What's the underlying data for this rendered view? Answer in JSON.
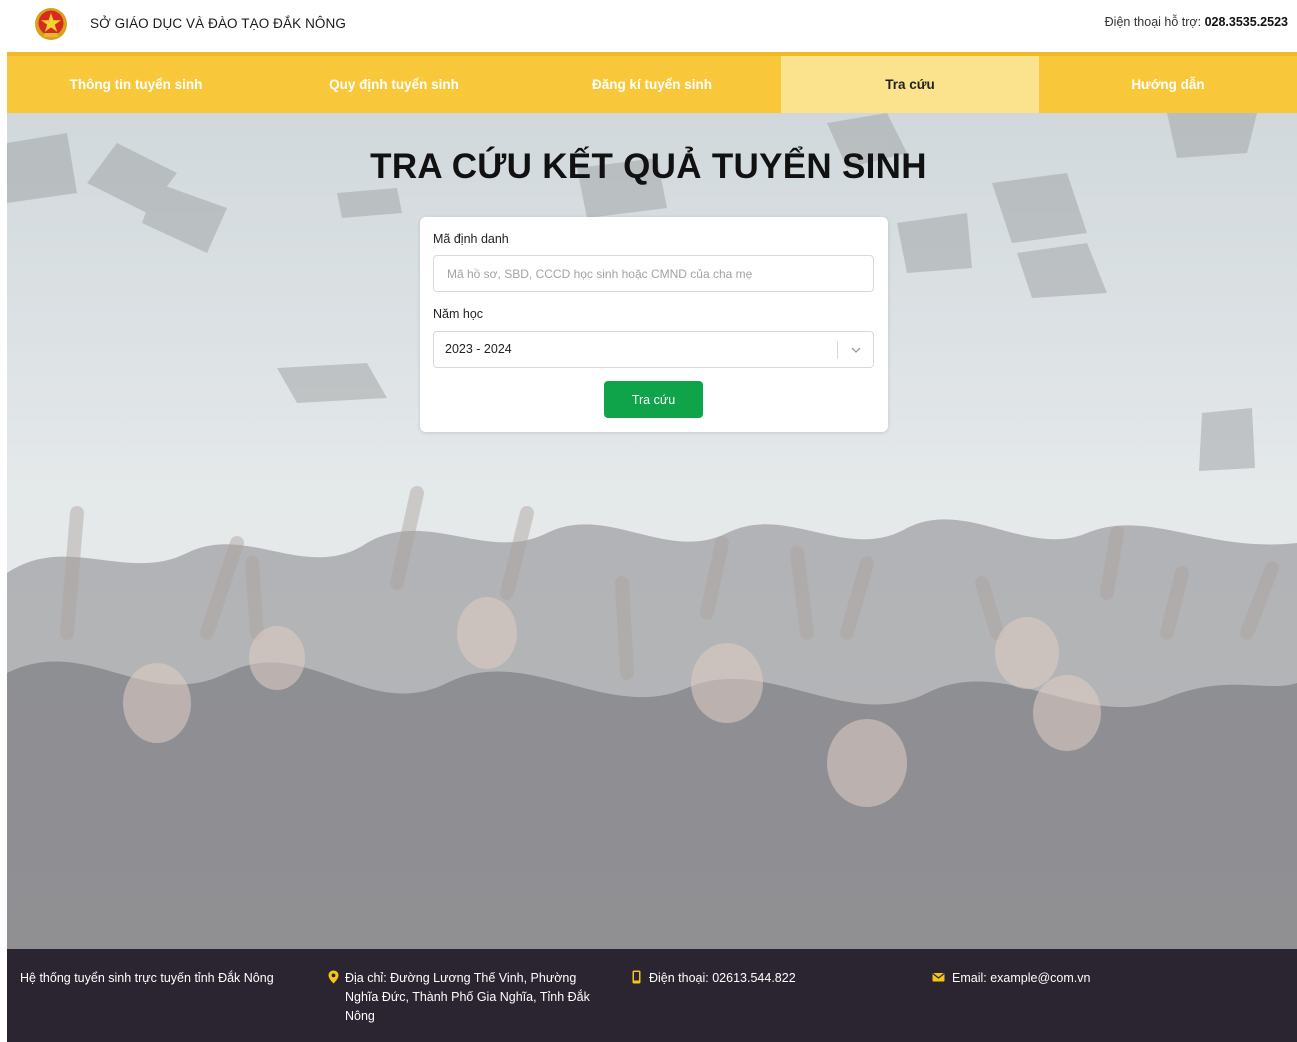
{
  "header": {
    "org_name": "SỞ GIÁO DỤC VÀ ĐÀO TẠO ĐẮK NÔNG",
    "support_label": "Điện thoại hỗ trợ:",
    "support_phone": "028.3535.2523"
  },
  "nav": {
    "items": [
      {
        "label": "Thông tin tuyển sinh"
      },
      {
        "label": "Quy định tuyển sinh"
      },
      {
        "label": "Đăng kí tuyển sinh"
      },
      {
        "label": "Tra cứu"
      },
      {
        "label": "Hướng dẫn"
      }
    ],
    "active_index": 3
  },
  "main": {
    "title": "TRA CỨU KẾT QUẢ TUYỂN SINH",
    "form": {
      "id_label": "Mã định danh",
      "id_placeholder": "Mã hồ sơ, SBD, CCCD học sinh hoặc CMND của cha mẹ",
      "id_value": "",
      "year_label": "Năm học",
      "year_value": "2023 - 2024",
      "submit_label": "Tra cứu"
    }
  },
  "footer": {
    "system_name": "Hệ thống tuyển sinh trực tuyến tỉnh Đắk Nông",
    "address": "Địa chỉ: Đường Lương Thế Vinh, Phường Nghĩa Đức, Thành Phố Gia Nghĩa, Tỉnh Đắk Nông",
    "phone": "Điện thoại: 02613.544.822",
    "email": "Email: example@com.vn"
  },
  "colors": {
    "nav_bg": "#f9c83a",
    "nav_active_bg": "#fbe38d",
    "button_bg": "#0fa34a",
    "footer_bg": "#2b2431",
    "icon_yellow": "#f5c518"
  },
  "icons": {
    "emblem": "national-emblem",
    "address": "map-pin-icon",
    "phone": "phone-icon",
    "email": "envelope-icon",
    "select": "chevron-down-icon"
  }
}
